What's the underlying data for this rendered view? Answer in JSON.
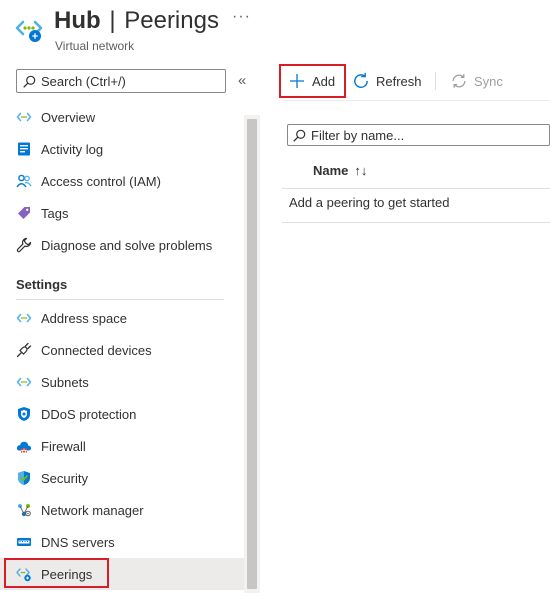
{
  "header": {
    "resource_name": "Hub",
    "separator": "|",
    "page_name": "Peerings",
    "subtitle": "Virtual network",
    "more": "···"
  },
  "sidebar": {
    "search_placeholder": "Search (Ctrl+/)",
    "collapse": "«",
    "items_top": [
      {
        "label": "Overview",
        "icon": "vnet-icon"
      },
      {
        "label": "Activity log",
        "icon": "activity-log-icon"
      },
      {
        "label": "Access control (IAM)",
        "icon": "people-icon"
      },
      {
        "label": "Tags",
        "icon": "tag-icon"
      },
      {
        "label": "Diagnose and solve problems",
        "icon": "wrench-icon"
      }
    ],
    "settings_label": "Settings",
    "items_settings": [
      {
        "label": "Address space",
        "icon": "vnet-icon"
      },
      {
        "label": "Connected devices",
        "icon": "plug-icon"
      },
      {
        "label": "Subnets",
        "icon": "vnet-icon"
      },
      {
        "label": "DDoS protection",
        "icon": "shield-icon"
      },
      {
        "label": "Firewall",
        "icon": "firewall-cloud-icon"
      },
      {
        "label": "Security",
        "icon": "security-shield-icon"
      },
      {
        "label": "Network manager",
        "icon": "network-manager-icon"
      },
      {
        "label": "DNS servers",
        "icon": "dns-icon"
      },
      {
        "label": "Peerings",
        "icon": "peerings-icon",
        "active": true
      }
    ]
  },
  "toolbar": {
    "add_label": "Add",
    "refresh_label": "Refresh",
    "sync_label": "Sync"
  },
  "main": {
    "filter_placeholder": "Filter by name...",
    "column_name": "Name",
    "sort_glyph": "↑↓",
    "empty_message": "Add a peering to get started"
  },
  "colors": {
    "accent": "#0078d4",
    "highlight_border": "#d71e28",
    "active_bg": "#edebe9"
  }
}
